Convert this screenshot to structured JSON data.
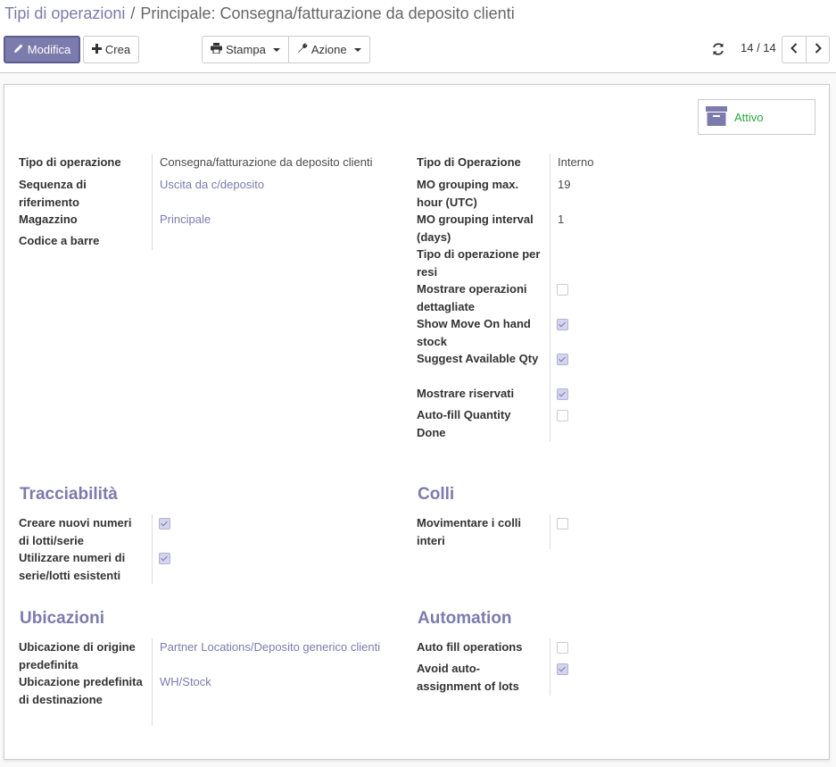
{
  "breadcrumb": {
    "parent": "Tipi di operazioni",
    "separator": "/",
    "current": "Principale: Consegna/fatturazione da deposito clienti"
  },
  "toolbar": {
    "edit_label": "Modifica",
    "create_label": "Crea",
    "print_label": "Stampa",
    "action_label": "Azione"
  },
  "pager": {
    "value": "14 / 14"
  },
  "status_button": {
    "label": "Attivo"
  },
  "main_left": {
    "fields": [
      {
        "label": "Tipo di operazione",
        "value": "Consegna/fatturazione da deposito clienti"
      },
      {
        "label": "Sequenza di riferimento",
        "value": "Uscita da c/deposito"
      },
      {
        "label": "Magazzino",
        "value": "Principale"
      },
      {
        "label": "Codice a barre",
        "value": ""
      }
    ]
  },
  "main_right": {
    "fields": [
      {
        "label": "Tipo di Operazione",
        "value": "Interno"
      },
      {
        "label": "MO grouping max. hour (UTC)",
        "value": "19"
      },
      {
        "label": "MO grouping interval (days)",
        "value": "1"
      },
      {
        "label": "Tipo di operazione per resi",
        "value": ""
      },
      {
        "label": "Mostrare operazioni dettagliate",
        "checked": false
      },
      {
        "label": "Show Move On hand stock",
        "checked": true
      },
      {
        "label": "Suggest Available Qty",
        "checked": true
      },
      {
        "label": "Mostrare riservati",
        "checked": true
      },
      {
        "label": "Auto-fill Quantity Done",
        "checked": false
      }
    ]
  },
  "traceability": {
    "title": "Tracciabilità",
    "fields": [
      {
        "label": "Creare nuovi numeri di lotti/serie",
        "checked": true
      },
      {
        "label": "Utilizzare numeri di serie/lotti esistenti",
        "checked": true
      }
    ]
  },
  "packages": {
    "title": "Colli",
    "fields": [
      {
        "label": "Movimentare i colli interi",
        "checked": false
      }
    ]
  },
  "locations": {
    "title": "Ubicazioni",
    "fields": [
      {
        "label": "Ubicazione di origine predefinita",
        "value": "Partner Locations/Deposito generico clienti"
      },
      {
        "label": "Ubicazione predefinita di destinazione",
        "value": "WH/Stock"
      }
    ]
  },
  "automation": {
    "title": "Automation",
    "fields": [
      {
        "label": "Auto fill operations",
        "checked": false
      },
      {
        "label": "Avoid auto-assignment of lots",
        "checked": true
      }
    ]
  },
  "colors": {
    "primary": "#7c7bad",
    "active": "#28a745"
  }
}
